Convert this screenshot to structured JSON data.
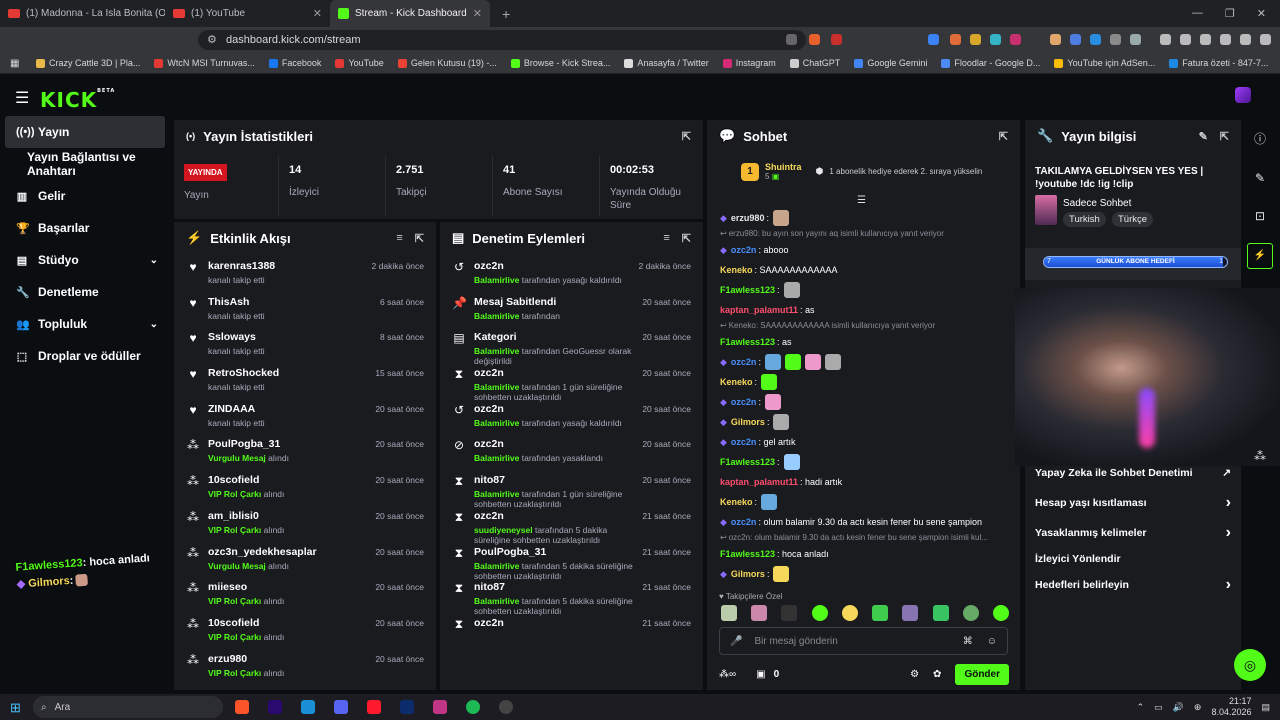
{
  "browser": {
    "tabs": [
      {
        "title": "(1) Madonna - La Isla Bonita (Off..."
      },
      {
        "title": "(1) YouTube"
      },
      {
        "title": "Stream - Kick Dashboard"
      }
    ],
    "url": "dashboard.kick.com/stream",
    "bookmarks": [
      "Crazy Cattle 3D | Pla...",
      "WtcN MSI Turnuvas...",
      "Facebook",
      "YouTube",
      "Gelen Kutusu (19) -...",
      "Browse - Kick Strea...",
      "Anasayfa / Twitter",
      "Instagram",
      "ChatGPT",
      "Google Gemini",
      "Floodlar - Google D...",
      "YouTube için AdSen...",
      "Fatura özeti - 847-7..."
    ]
  },
  "app": {
    "logo": "KICK",
    "logo_sup": "BETA",
    "sidebar": [
      {
        "label": "Yayın",
        "icon": "broadcast-icon"
      },
      {
        "label": "Yayın Bağlantısı ve Anahtarı",
        "icon": ""
      },
      {
        "label": "Gelir",
        "icon": "chart-icon"
      },
      {
        "label": "Başarılar",
        "icon": "trophy-icon"
      },
      {
        "label": "Stüdyo",
        "icon": "studio-icon"
      },
      {
        "label": "Denetleme",
        "icon": "wrench-icon"
      },
      {
        "label": "Topluluk",
        "icon": "people-icon"
      },
      {
        "label": "Droplar ve ödüller",
        "icon": "drops-icon"
      }
    ],
    "overlay_chat": [
      {
        "user": "F1awless123",
        "text": ": hoca anladı"
      },
      {
        "user": "Gilmors",
        "text": ":"
      }
    ]
  },
  "stats": {
    "title": "Yayın İstatistikleri",
    "live_badge": "YAYINDA",
    "items": [
      {
        "value": "",
        "label": "Yayın"
      },
      {
        "value": "14",
        "label": "İzleyici"
      },
      {
        "value": "2.751",
        "label": "Takipçi"
      },
      {
        "value": "41",
        "label": "Abone Sayısı"
      },
      {
        "value": "00:02:53",
        "label": "Yayında Olduğu Süre"
      }
    ]
  },
  "activity": {
    "title": "Etkinlik Akışı",
    "rows": [
      {
        "name": "karenras1388",
        "pre": "",
        "hl": "",
        "post": "kanalı takip etti",
        "time": "2 dakika önce",
        "icon": "heart"
      },
      {
        "name": "ThisAsh",
        "pre": "",
        "hl": "",
        "post": "kanalı takip etti",
        "time": "6 saat önce",
        "icon": "heart"
      },
      {
        "name": "Ssloways",
        "pre": "",
        "hl": "",
        "post": "kanalı takip etti",
        "time": "8 saat önce",
        "icon": "heart"
      },
      {
        "name": "RetroShocked",
        "pre": "",
        "hl": "",
        "post": "kanalı takip etti",
        "time": "15 saat önce",
        "icon": "heart"
      },
      {
        "name": "ZINDAAA",
        "pre": "",
        "hl": "",
        "post": "kanalı takip etti",
        "time": "20 saat önce",
        "icon": "heart"
      },
      {
        "name": "PoulPogba_31",
        "pre": "",
        "hl": "Vurgulu Mesaj",
        "post": " alındı",
        "time": "20 saat önce",
        "icon": "drops"
      },
      {
        "name": "10scofield",
        "pre": "",
        "hl": "VIP Rol Çarkı",
        "post": " alındı",
        "time": "20 saat önce",
        "icon": "drops"
      },
      {
        "name": "am_iblisi0",
        "pre": "",
        "hl": "VIP Rol Çarkı",
        "post": " alındı",
        "time": "20 saat önce",
        "icon": "drops"
      },
      {
        "name": "ozc3n_yedekhesaplar",
        "pre": "",
        "hl": "Vurgulu Mesaj",
        "post": " alındı",
        "time": "20 saat önce",
        "icon": "drops"
      },
      {
        "name": "miieseo",
        "pre": "",
        "hl": "VIP Rol Çarkı",
        "post": " alındı",
        "time": "20 saat önce",
        "icon": "drops"
      },
      {
        "name": "10scofield",
        "pre": "",
        "hl": "VIP Rol Çarkı",
        "post": " alındı",
        "time": "20 saat önce",
        "icon": "drops"
      },
      {
        "name": "erzu980",
        "pre": "",
        "hl": "VIP Rol Çarkı",
        "post": " alındı",
        "time": "20 saat önce",
        "icon": "drops"
      }
    ]
  },
  "moderation": {
    "title": "Denetim Eylemleri",
    "rows": [
      {
        "name": "ozc2n",
        "actor": "Balamirlive",
        "text": " tarafından yasağı kaldırıldı",
        "time": "2 dakika önce",
        "icon": "undo"
      },
      {
        "name": "Mesaj Sabitlendi",
        "actor": "Balamirlive",
        "text": " tarafından",
        "time": "20 saat önce",
        "icon": "pin"
      },
      {
        "name": "Kategori",
        "actor": "Balamirlive",
        "text": " tarafından GeoGuessr olarak değiştirildi",
        "time": "20 saat önce",
        "icon": "doc"
      },
      {
        "name": "ozc2n",
        "actor": "Balamirlive",
        "text": " tarafından 1 gün süreliğine sohbetten uzaklaştırıldı",
        "time": "20 saat önce",
        "icon": "hourglass"
      },
      {
        "name": "ozc2n",
        "actor": "Balamirlive",
        "text": " tarafından yasağı kaldırıldı",
        "time": "20 saat önce",
        "icon": "undo"
      },
      {
        "name": "ozc2n",
        "actor": "Balamirlive",
        "text": " tarafından yasaklandı",
        "time": "20 saat önce",
        "icon": "ban"
      },
      {
        "name": "nito87",
        "actor": "Balamirlive",
        "text": " tarafından 1 gün süreliğine sohbetten uzaklaştırıldı",
        "time": "20 saat önce",
        "icon": "hourglass"
      },
      {
        "name": "ozc2n",
        "actor": "suudiyeneysel",
        "text": " tarafından 5 dakika süreliğine sohbetten uzaklaştırıldı",
        "time": "21 saat önce",
        "icon": "hourglass"
      },
      {
        "name": "PoulPogba_31",
        "actor": "Balamirlive",
        "text": " tarafından 5 dakika süreliğine sohbetten uzaklaştırıldı",
        "time": "21 saat önce",
        "icon": "hourglass"
      },
      {
        "name": "nito87",
        "actor": "Balamirlive",
        "text": " tarafından 5 dakika süreliğine sohbetten uzaklaştırıldı",
        "time": "21 saat önce",
        "icon": "hourglass"
      },
      {
        "name": "ozc2n",
        "actor": "",
        "text": "",
        "time": "21 saat önce",
        "icon": "hourglass"
      }
    ]
  },
  "chat": {
    "title": "Sohbet",
    "pinned_user": "Shuintra",
    "pinned_rank": "1",
    "pinned_count": "5",
    "pinned_text": "1 abonelik hediye ederek 2. sıraya yükselin",
    "messages": [
      {
        "type": "msg",
        "user": "erzu980",
        "color": "#e8e8e8",
        "text": ":",
        "emotes": 1
      },
      {
        "type": "reply",
        "text": "erzu980: bu ayın son yayını aq isimli kullanıcıya yanıt veriyor"
      },
      {
        "type": "msg",
        "user": "ozc2n",
        "color": "#4a90ff",
        "text": ": abooo",
        "emotes": 0
      },
      {
        "type": "msg",
        "user": "Keneko",
        "color": "#f5d85a",
        "text": ": SAAAAAAAAAAAA",
        "emotes": 0
      },
      {
        "type": "msg",
        "user": "F1awless123",
        "color": "#53fc18",
        "text": ":",
        "emotes": 1
      },
      {
        "type": "msg",
        "user": "kaptan_palamut11",
        "color": "#ff4d6d",
        "text": ": as",
        "emotes": 0
      },
      {
        "type": "reply",
        "text": "Keneko: SAAAAAAAAAAAA isimli kullanıcıya yanıt veriyor"
      },
      {
        "type": "msg",
        "user": "F1awless123",
        "color": "#53fc18",
        "text": ": as",
        "emotes": 0
      },
      {
        "type": "msg",
        "user": "ozc2n",
        "color": "#4a90ff",
        "text": ":",
        "emotes": 4
      },
      {
        "type": "msg",
        "user": "Keneko",
        "color": "#f5d85a",
        "text": ":",
        "emotes": 1
      },
      {
        "type": "msg",
        "user": "ozc2n",
        "color": "#4a90ff",
        "text": ":",
        "emotes": 1
      },
      {
        "type": "msg",
        "user": "Gilmors",
        "color": "#f5d85a",
        "text": ":",
        "emotes": 1
      },
      {
        "type": "msg",
        "user": "ozc2n",
        "color": "#4a90ff",
        "text": ": gel artık",
        "emotes": 0
      },
      {
        "type": "msg",
        "user": "F1awless123",
        "color": "#53fc18",
        "text": ":",
        "emotes": 1
      },
      {
        "type": "msg",
        "user": "kaptan_palamut11",
        "color": "#ff4d6d",
        "text": ": hadi artık",
        "emotes": 0
      },
      {
        "type": "msg",
        "user": "Keneko",
        "color": "#f5d85a",
        "text": ":",
        "emotes": 1
      },
      {
        "type": "msg",
        "user": "ozc2n",
        "color": "#4a90ff",
        "text": ": olum balamir 9.30 da actı kesin fener bu sene şampion",
        "emotes": 0
      },
      {
        "type": "reply",
        "text": "ozc2n: olum balamir 9.30 da actı kesin fener bu sene şampion isimli kul..."
      },
      {
        "type": "msg",
        "user": "F1awless123",
        "color": "#53fc18",
        "text": ": hoca anladı",
        "emotes": 0
      },
      {
        "type": "msg",
        "user": "Gilmors",
        "color": "#f5d85a",
        "text": ":",
        "emotes": 1
      }
    ],
    "followers_label": "Takipçilere Özel",
    "input_placeholder": "Bir mesaj gönderin",
    "points": "0",
    "send_label": "Gönder"
  },
  "stream_info": {
    "title": "Yayın bilgisi",
    "stream_title": "TAKILAMYA GELDİYSEN YES YES | !youtube !dc !ig !clip",
    "category": "Sadece Sohbet",
    "tags": [
      "Turkish",
      "Türkçe"
    ],
    "goal_label": "GÜNLÜK ABONE HEDEFİ",
    "goal_start": "7",
    "goal_end": "1",
    "goal_progress": 0.98,
    "settings": [
      {
        "label": "Yapay Zeka ile Sohbet Denetimi",
        "arrow": "↗"
      },
      {
        "label": "Hesap yaşı kısıtlaması",
        "arrow": "›"
      },
      {
        "label": "Yasaklanmış kelimeler",
        "arrow": "›"
      },
      {
        "label": "İzleyici Yönlendir",
        "arrow": ""
      },
      {
        "label": "Hedefleri belirleyin",
        "arrow": "›"
      }
    ]
  },
  "taskbar": {
    "search_placeholder": "Ara",
    "time": "21:17",
    "date": "8.04.2026"
  },
  "colors": {
    "accent": "#53fc18",
    "live": "#d3151f",
    "panel": "#191b1f",
    "bg": "#0b0e11"
  }
}
